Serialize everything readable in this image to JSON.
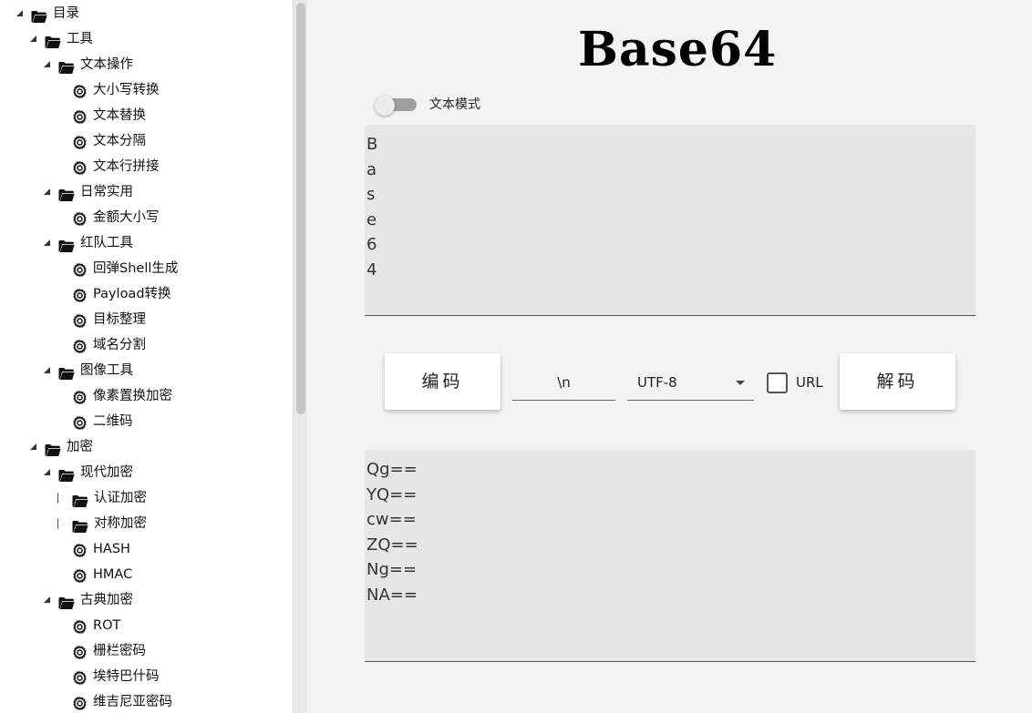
{
  "tree": [
    {
      "label": "目录",
      "kind": "folder",
      "state": "expanded",
      "depth": 0
    },
    {
      "label": "工具",
      "kind": "folder",
      "state": "expanded",
      "depth": 1
    },
    {
      "label": "文本操作",
      "kind": "folder",
      "state": "expanded",
      "depth": 2
    },
    {
      "label": "大小写转换",
      "kind": "tool",
      "state": "none",
      "depth": 3
    },
    {
      "label": "文本替换",
      "kind": "tool",
      "state": "none",
      "depth": 3
    },
    {
      "label": "文本分隔",
      "kind": "tool",
      "state": "none",
      "depth": 3
    },
    {
      "label": "文本行拼接",
      "kind": "tool",
      "state": "none",
      "depth": 3
    },
    {
      "label": "日常实用",
      "kind": "folder",
      "state": "expanded",
      "depth": 2
    },
    {
      "label": "金额大小写",
      "kind": "tool",
      "state": "none",
      "depth": 3
    },
    {
      "label": "红队工具",
      "kind": "folder",
      "state": "expanded",
      "depth": 2
    },
    {
      "label": "回弹Shell生成",
      "kind": "tool",
      "state": "none",
      "depth": 3
    },
    {
      "label": "Payload转换",
      "kind": "tool",
      "state": "none",
      "depth": 3
    },
    {
      "label": "目标整理",
      "kind": "tool",
      "state": "none",
      "depth": 3
    },
    {
      "label": "域名分割",
      "kind": "tool",
      "state": "none",
      "depth": 3
    },
    {
      "label": "图像工具",
      "kind": "folder",
      "state": "expanded",
      "depth": 2
    },
    {
      "label": "像素置换加密",
      "kind": "tool",
      "state": "none",
      "depth": 3
    },
    {
      "label": "二维码",
      "kind": "tool",
      "state": "none",
      "depth": 3
    },
    {
      "label": "加密",
      "kind": "folder",
      "state": "expanded",
      "depth": 1
    },
    {
      "label": "现代加密",
      "kind": "folder",
      "state": "expanded",
      "depth": 2
    },
    {
      "label": "认证加密",
      "kind": "folder",
      "state": "collapsed",
      "depth": 3
    },
    {
      "label": "对称加密",
      "kind": "folder",
      "state": "collapsed",
      "depth": 3
    },
    {
      "label": "HASH",
      "kind": "tool",
      "state": "none",
      "depth": 3
    },
    {
      "label": "HMAC",
      "kind": "tool",
      "state": "none",
      "depth": 3
    },
    {
      "label": "古典加密",
      "kind": "folder",
      "state": "expanded",
      "depth": 2
    },
    {
      "label": "ROT",
      "kind": "tool",
      "state": "none",
      "depth": 3
    },
    {
      "label": "栅栏密码",
      "kind": "tool",
      "state": "none",
      "depth": 3
    },
    {
      "label": "埃特巴什码",
      "kind": "tool",
      "state": "none",
      "depth": 3
    },
    {
      "label": "维吉尼亚密码",
      "kind": "tool",
      "state": "none",
      "depth": 3
    }
  ],
  "main": {
    "logo": "Base64",
    "toggle_label": "文本模式",
    "toggle_on": false,
    "input_lines": [
      "B",
      "a",
      "s",
      "e",
      "6",
      "4"
    ],
    "encode_label": "编码",
    "separator_value": "\\n",
    "charset_value": "UTF-8",
    "url_label": "URL",
    "url_checked": false,
    "decode_label": "解码",
    "output_lines": [
      "Qg==",
      "YQ==",
      "cw==",
      "ZQ==",
      "Ng==",
      "NA=="
    ]
  }
}
